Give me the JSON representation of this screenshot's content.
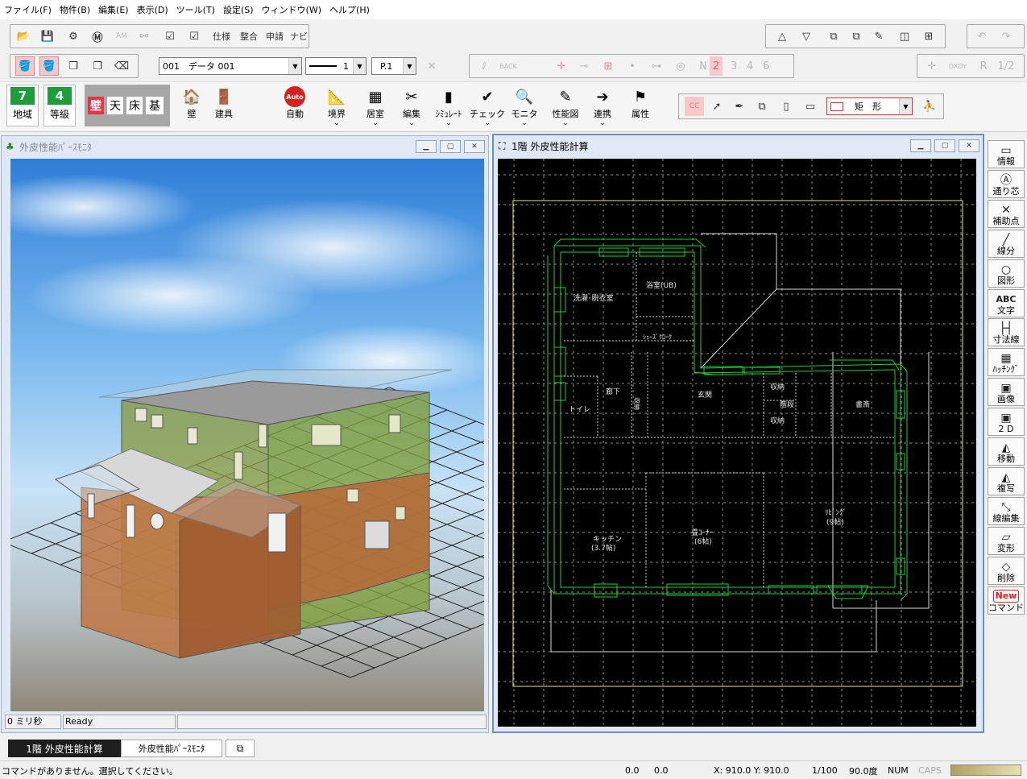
{
  "menu": [
    "ファイル(F)",
    "物件(B)",
    "編集(E)",
    "表示(D)",
    "ツール(T)",
    "設定(S)",
    "ウィンドウ(W)",
    "ヘルプ(H)"
  ],
  "toolbar1": {
    "shiyou": "仕様",
    "seigou": "整合",
    "shinsei": "申請",
    "navi": "ナビ"
  },
  "toolbar2": {
    "data_combo": "001　データ 001",
    "line_width": "1",
    "page": "P.1",
    "back": "BACK",
    "nums": [
      "2",
      "3",
      "4",
      "6"
    ],
    "n_label": "N",
    "dxdy": "DXDY",
    "r_label": "R",
    "half": "1/2"
  },
  "ribbon": {
    "chiiki_num": "7",
    "chiiki_label": "地域",
    "toukyu_num": "4",
    "toukyu_label": "等級",
    "kabe": "壁",
    "ten": "天",
    "yuka": "床",
    "moto": "基",
    "buttons": [
      "壁",
      "建具",
      "自動",
      "境界",
      "居室",
      "編集",
      "ｼﾐｭﾚｰﾄ",
      "チェック",
      "モニタ",
      "性能図",
      "連携",
      "属性"
    ],
    "auto": "Auto",
    "shape_combo": "矩　形"
  },
  "left_window": {
    "title": "外皮性能ﾊﾟｰｽﾓﾆﾀ",
    "status_time": "0 ミリ秒",
    "status_text": "Ready"
  },
  "right_window": {
    "title": "1階 外皮性能計算"
  },
  "rooms": [
    "洗濯･脱衣室",
    "浴室(UB)",
    "ｼｭｰｽﾞｸﾛｰｸ",
    "廊下",
    "収納",
    "玄関",
    "収納",
    "階段",
    "書斎",
    "収納",
    "トイレ",
    "ﾘﾋﾞﾝｸﾞ",
    "(9帖)",
    "キッチン",
    "(3.7帖)",
    "畳ｺｰﾅｰ",
    "(6帖)"
  ],
  "right_tools": [
    {
      "icon": "ruler-icon",
      "label": "情報"
    },
    {
      "icon": "grid-axis-icon",
      "label": "通り芯"
    },
    {
      "icon": "aux-point-icon",
      "label": "補助点"
    },
    {
      "icon": "line-icon",
      "label": "線分"
    },
    {
      "icon": "shape-icon",
      "label": "図形"
    },
    {
      "icon": "text-icon",
      "label": "文字"
    },
    {
      "icon": "dimension-icon",
      "label": "寸法線"
    },
    {
      "icon": "hatching-icon",
      "label": "ﾊｯﾁﾝｸﾞ"
    },
    {
      "icon": "image-icon",
      "label": "画像"
    },
    {
      "icon": "2d-icon",
      "label": "2D"
    },
    {
      "icon": "move-icon",
      "label": "移動"
    },
    {
      "icon": "copy-icon",
      "label": "複写"
    },
    {
      "icon": "line-edit-icon",
      "label": "線編集"
    },
    {
      "icon": "deform-icon",
      "label": "変形"
    },
    {
      "icon": "eraser-icon",
      "label": "削除"
    },
    {
      "icon": "new-icon",
      "label": "コマンド"
    }
  ],
  "right_tools_glyphs": {
    "abc": "ABC",
    "new": "New",
    "twod": "2 D"
  },
  "tabs": [
    "1階 外皮性能計算",
    "外皮性能ﾊﾟｰｽﾓﾆﾀ"
  ],
  "status": {
    "message": "コマンドがありません。選択してください。",
    "v1": "0.0",
    "v2": "0.0",
    "coords": "X: 910.0  Y: 910.0",
    "scale": "1/100",
    "angle": "90.0度",
    "num": "NUM",
    "caps": "CAPS"
  },
  "colors": {
    "accent_green": "#1e9e3a",
    "wall_red": "#e4384a",
    "plan_bg": "#000000",
    "plan_line": "#19d430",
    "plan_border": "#e8e87a"
  }
}
